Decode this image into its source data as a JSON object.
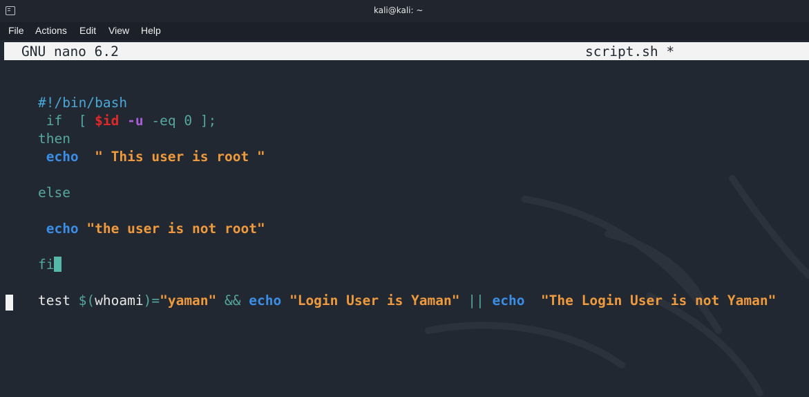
{
  "window": {
    "title": "kali@kali: ~",
    "icon": "terminal-icon"
  },
  "menu": [
    "File",
    "Actions",
    "Edit",
    "View",
    "Help"
  ],
  "nano": {
    "app": "GNU nano 6.2",
    "file": "script.sh *"
  },
  "code": {
    "shebang": "#!/bin/bash",
    "l2_if": " if  [ ",
    "l2_var": "$id",
    "l2_opt": " -u",
    "l2_rest": " -eq 0 ];",
    "l3": "then",
    "l4_kw": " echo",
    "l4_str": "  \" This user is root \"",
    "l5": "else",
    "l6_kw": " echo",
    "l6_str": " \"the user is not root\"",
    "l7": "fi",
    "l8_test": "test ",
    "l8_sub": "$(",
    "l8_cmd": "whoami",
    "l8_close": ")=",
    "l8_str1": "\"yaman\"",
    "l8_and": " && ",
    "l8_kw1": "echo",
    "l8_str2": " \"Login User is Yaman\"",
    "l8_or": " || ",
    "l8_kw2": "echo",
    "l8_str3": "  \"The Login User is not Yaman\""
  },
  "colors": {
    "comment": "#4aa8d8",
    "keyword": "#3a8ee6",
    "string": "#f09a3e",
    "variable": "#e0282b",
    "option": "#a75fd6",
    "control": "#55a7a0",
    "background": "#222831"
  }
}
